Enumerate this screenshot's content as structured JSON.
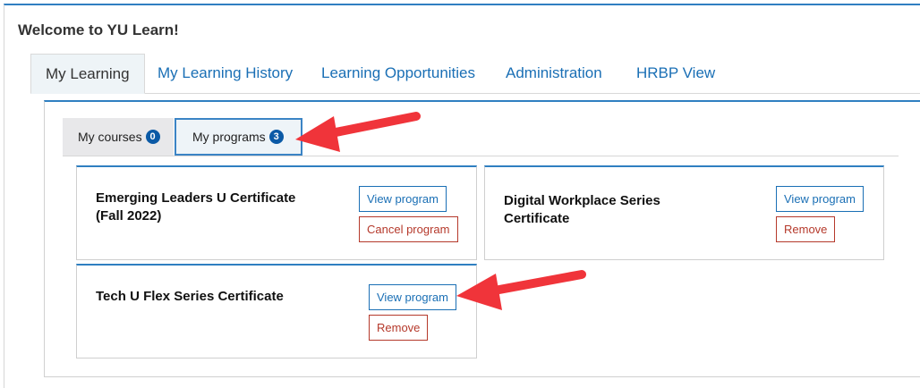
{
  "page": {
    "title": "Welcome to YU Learn!"
  },
  "main_tabs": [
    {
      "label": "My Learning",
      "active": true
    },
    {
      "label": "My Learning History",
      "active": false
    },
    {
      "label": "Learning Opportunities",
      "active": false
    },
    {
      "label": "Administration",
      "active": false
    },
    {
      "label": "HRBP View",
      "active": false
    }
  ],
  "sub_tabs": {
    "courses": {
      "label": "My courses",
      "count": "0"
    },
    "programs": {
      "label": "My programs",
      "count": "3",
      "active": true
    }
  },
  "programs": [
    {
      "title_line1": "Emerging Leaders U Certificate",
      "title_line2": "(Fall 2022)",
      "view_label": "View program",
      "secondary_label": "Cancel program"
    },
    {
      "title_line1": "Digital Workplace Series",
      "title_line2": "Certificate",
      "view_label": "View program",
      "secondary_label": "Remove"
    },
    {
      "title_line1": "Tech U Flex Series Certificate",
      "title_line2": "",
      "view_label": "View program",
      "secondary_label": "Remove"
    }
  ],
  "colors": {
    "accent_blue": "#2f7fc1",
    "link_blue": "#1a6fb5",
    "badge_blue": "#0b5aa6",
    "danger_red": "#b5392b",
    "annotation_red": "#f0343a"
  }
}
